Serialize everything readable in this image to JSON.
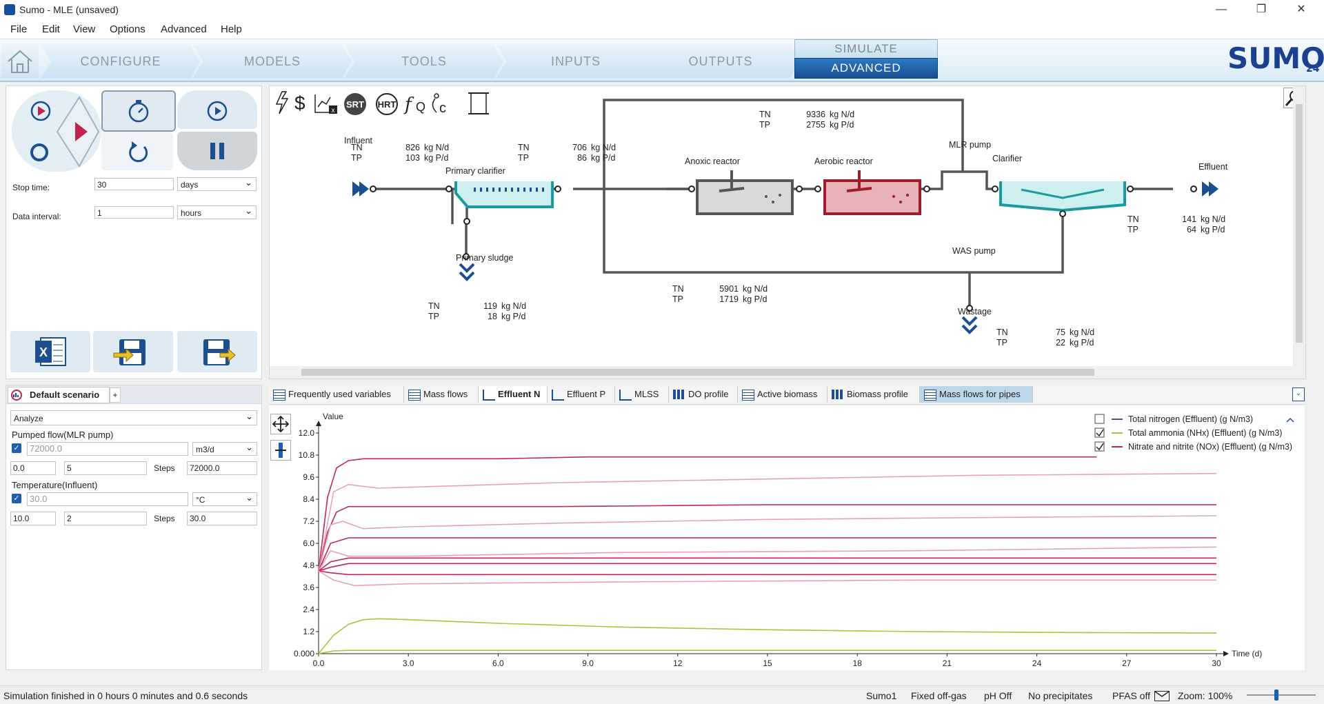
{
  "window": {
    "title": "Sumo - MLE (unsaved)",
    "minimize": "—",
    "restore": "❐",
    "close": "✕"
  },
  "menu": [
    "File",
    "Edit",
    "View",
    "Options",
    "Advanced",
    "Help"
  ],
  "nav": {
    "tabs": [
      "CONFIGURE",
      "MODELS",
      "TOOLS",
      "INPUTS",
      "OUTPUTS"
    ],
    "simulate_label": "SIMULATE",
    "advanced_label": "ADVANCED",
    "brand": "SUMO",
    "brand_version": "24"
  },
  "control_panel": {
    "stop_time_label": "Stop time:",
    "stop_time_value": "30",
    "stop_time_unit": "days",
    "data_interval_label": "Data interval:",
    "data_interval_value": "1",
    "data_interval_unit": "hours"
  },
  "scenario": {
    "tab_label": "Default scenario",
    "add_label": "+",
    "mode": "Analyze",
    "param1": {
      "label": "Pumped flow(MLR pump)",
      "value": "72000.0",
      "unit": "m3/d",
      "from": "0.0",
      "count": "5",
      "steps_label": "Steps",
      "to": "72000.0"
    },
    "param2": {
      "label": "Temperature(Influent)",
      "value": "30.0",
      "unit": "°C",
      "from": "10.0",
      "count": "2",
      "steps_label": "Steps",
      "to": "30.0"
    }
  },
  "diagram": {
    "toolbar_icons": [
      "lightning-icon",
      "dollar-icon",
      "chart-excel-icon",
      "srt-icon",
      "hrt-icon",
      "function-icon",
      "temperature-icon",
      "scroll-icon"
    ],
    "srt": "SRT",
    "hrt": "HRT",
    "units": [
      "Influent",
      "Primary clarifier",
      "Primary sludge",
      "Anoxic reactor",
      "Aerobic reactor",
      "MLR pump",
      "Clarifier",
      "Effluent",
      "WAS pump",
      "Wastage"
    ],
    "flows": [
      {
        "tn": "826",
        "tp": "103"
      },
      {
        "tn": "706",
        "tp": "86"
      },
      {
        "tn": "9336",
        "tp": "2755"
      },
      {
        "tn": "141",
        "tp": "64"
      },
      {
        "tn": "119",
        "tp": "18"
      },
      {
        "tn": "5901",
        "tp": "1719"
      },
      {
        "tn": "75",
        "tp": "22"
      }
    ],
    "tn_label": "TN",
    "tp_label": "TP",
    "n_unit": "kg N/d",
    "p_unit": "kg P/d"
  },
  "chart_tabs": [
    "Frequently used variables",
    "Mass flows",
    "Effluent N",
    "Effluent P",
    "MLSS",
    "DO profile",
    "Active biomass",
    "Biomass profile",
    "Mass flows for pipes"
  ],
  "active_tab": "Effluent N",
  "chart_data": {
    "type": "line",
    "xlabel": "Time  (d)",
    "ylabel": "Value",
    "xlim": [
      0,
      30
    ],
    "ylim": [
      0,
      12
    ],
    "x_ticks": [
      "0.0",
      "3.0",
      "6.0",
      "9.0",
      "12",
      "15",
      "18",
      "21",
      "24",
      "27",
      "30"
    ],
    "y_ticks": [
      "0.000",
      "1.2",
      "2.4",
      "3.6",
      "4.8",
      "6.0",
      "7.2",
      "8.4",
      "9.6",
      "10.8",
      "12.0"
    ],
    "legend": [
      {
        "label": "Total nitrogen (Effluent) (g N/m3)",
        "color": "#4b4ba8",
        "checked": false
      },
      {
        "label": "Total ammonia (NHx) (Effluent) (g N/m3)",
        "color": "#b6bd3c",
        "checked": true
      },
      {
        "label": "Nitrate and nitrite (NOx) (Effluent) (g N/m3)",
        "color": "#c2255c",
        "checked": true
      }
    ],
    "series": [
      {
        "color": "#c2255c",
        "x": [
          0,
          0.3,
          0.6,
          1,
          1.5,
          3,
          6,
          9,
          12,
          18,
          24,
          26
        ],
        "y": [
          4.5,
          8.5,
          10.1,
          10.5,
          10.6,
          10.6,
          10.6,
          10.7,
          10.7,
          10.7,
          10.7,
          10.7
        ]
      },
      {
        "color": "#e8a2b8",
        "x": [
          0,
          0.5,
          1,
          2,
          4,
          8,
          15,
          22,
          30
        ],
        "y": [
          4.5,
          8.8,
          9.2,
          9.0,
          9.1,
          9.3,
          9.5,
          9.7,
          9.8
        ]
      },
      {
        "color": "#c2255c",
        "x": [
          0,
          0.3,
          0.6,
          1,
          2,
          8,
          15,
          22,
          30
        ],
        "y": [
          4.5,
          6.6,
          7.7,
          8.0,
          8.0,
          8.0,
          8.1,
          8.1,
          8.1
        ]
      },
      {
        "color": "#e8a2b8",
        "x": [
          0,
          0.4,
          0.8,
          1.5,
          3,
          8,
          15,
          22,
          30
        ],
        "y": [
          4.5,
          7.0,
          7.2,
          6.8,
          6.9,
          7.1,
          7.3,
          7.4,
          7.5
        ]
      },
      {
        "color": "#c2255c",
        "x": [
          0,
          0.4,
          1,
          3,
          10,
          20,
          30
        ],
        "y": [
          4.5,
          6.0,
          6.3,
          6.3,
          6.3,
          6.3,
          6.3
        ]
      },
      {
        "color": "#e8a2b8",
        "x": [
          0,
          0.4,
          1,
          3,
          10,
          20,
          30
        ],
        "y": [
          4.5,
          5.6,
          5.3,
          5.3,
          5.5,
          5.6,
          5.8
        ]
      },
      {
        "color": "#c2255c",
        "x": [
          0,
          0.4,
          1,
          3,
          10,
          20,
          30
        ],
        "y": [
          4.5,
          5.0,
          5.2,
          5.2,
          5.2,
          5.2,
          5.2
        ]
      },
      {
        "color": "#c2255c",
        "x": [
          0,
          0.4,
          1,
          3,
          10,
          20,
          30
        ],
        "y": [
          4.5,
          4.7,
          4.9,
          4.9,
          4.9,
          4.9,
          4.9
        ]
      },
      {
        "color": "#c2255c",
        "x": [
          0,
          0.4,
          1,
          3,
          10,
          20,
          30
        ],
        "y": [
          4.5,
          4.4,
          4.3,
          4.3,
          4.3,
          4.3,
          4.3
        ]
      },
      {
        "color": "#e8a2b8",
        "x": [
          0,
          0.5,
          1.2,
          3,
          10,
          20,
          30
        ],
        "y": [
          4.5,
          4.0,
          3.7,
          3.8,
          3.9,
          4.0,
          4.0
        ]
      },
      {
        "color": "#b6bd3c",
        "x": [
          0,
          0.5,
          1,
          1.5,
          2,
          3,
          6,
          10,
          15,
          20,
          25,
          30
        ],
        "y": [
          0,
          1.0,
          1.6,
          1.85,
          1.9,
          1.85,
          1.65,
          1.45,
          1.3,
          1.2,
          1.15,
          1.12
        ]
      },
      {
        "color": "#b6bd3c",
        "x": [
          0,
          0.5,
          1,
          3,
          10,
          20,
          30
        ],
        "y": [
          0,
          0.15,
          0.18,
          0.18,
          0.18,
          0.18,
          0.18
        ]
      }
    ]
  },
  "status": {
    "message": "Simulation finished in 0 hours 0 minutes and 0.6 seconds",
    "model": "Sumo1",
    "offgas": "Fixed off-gas",
    "ph": "pH Off",
    "precip": "No precipitates",
    "pfas": "PFAS off",
    "zoom": "Zoom: 100%"
  }
}
